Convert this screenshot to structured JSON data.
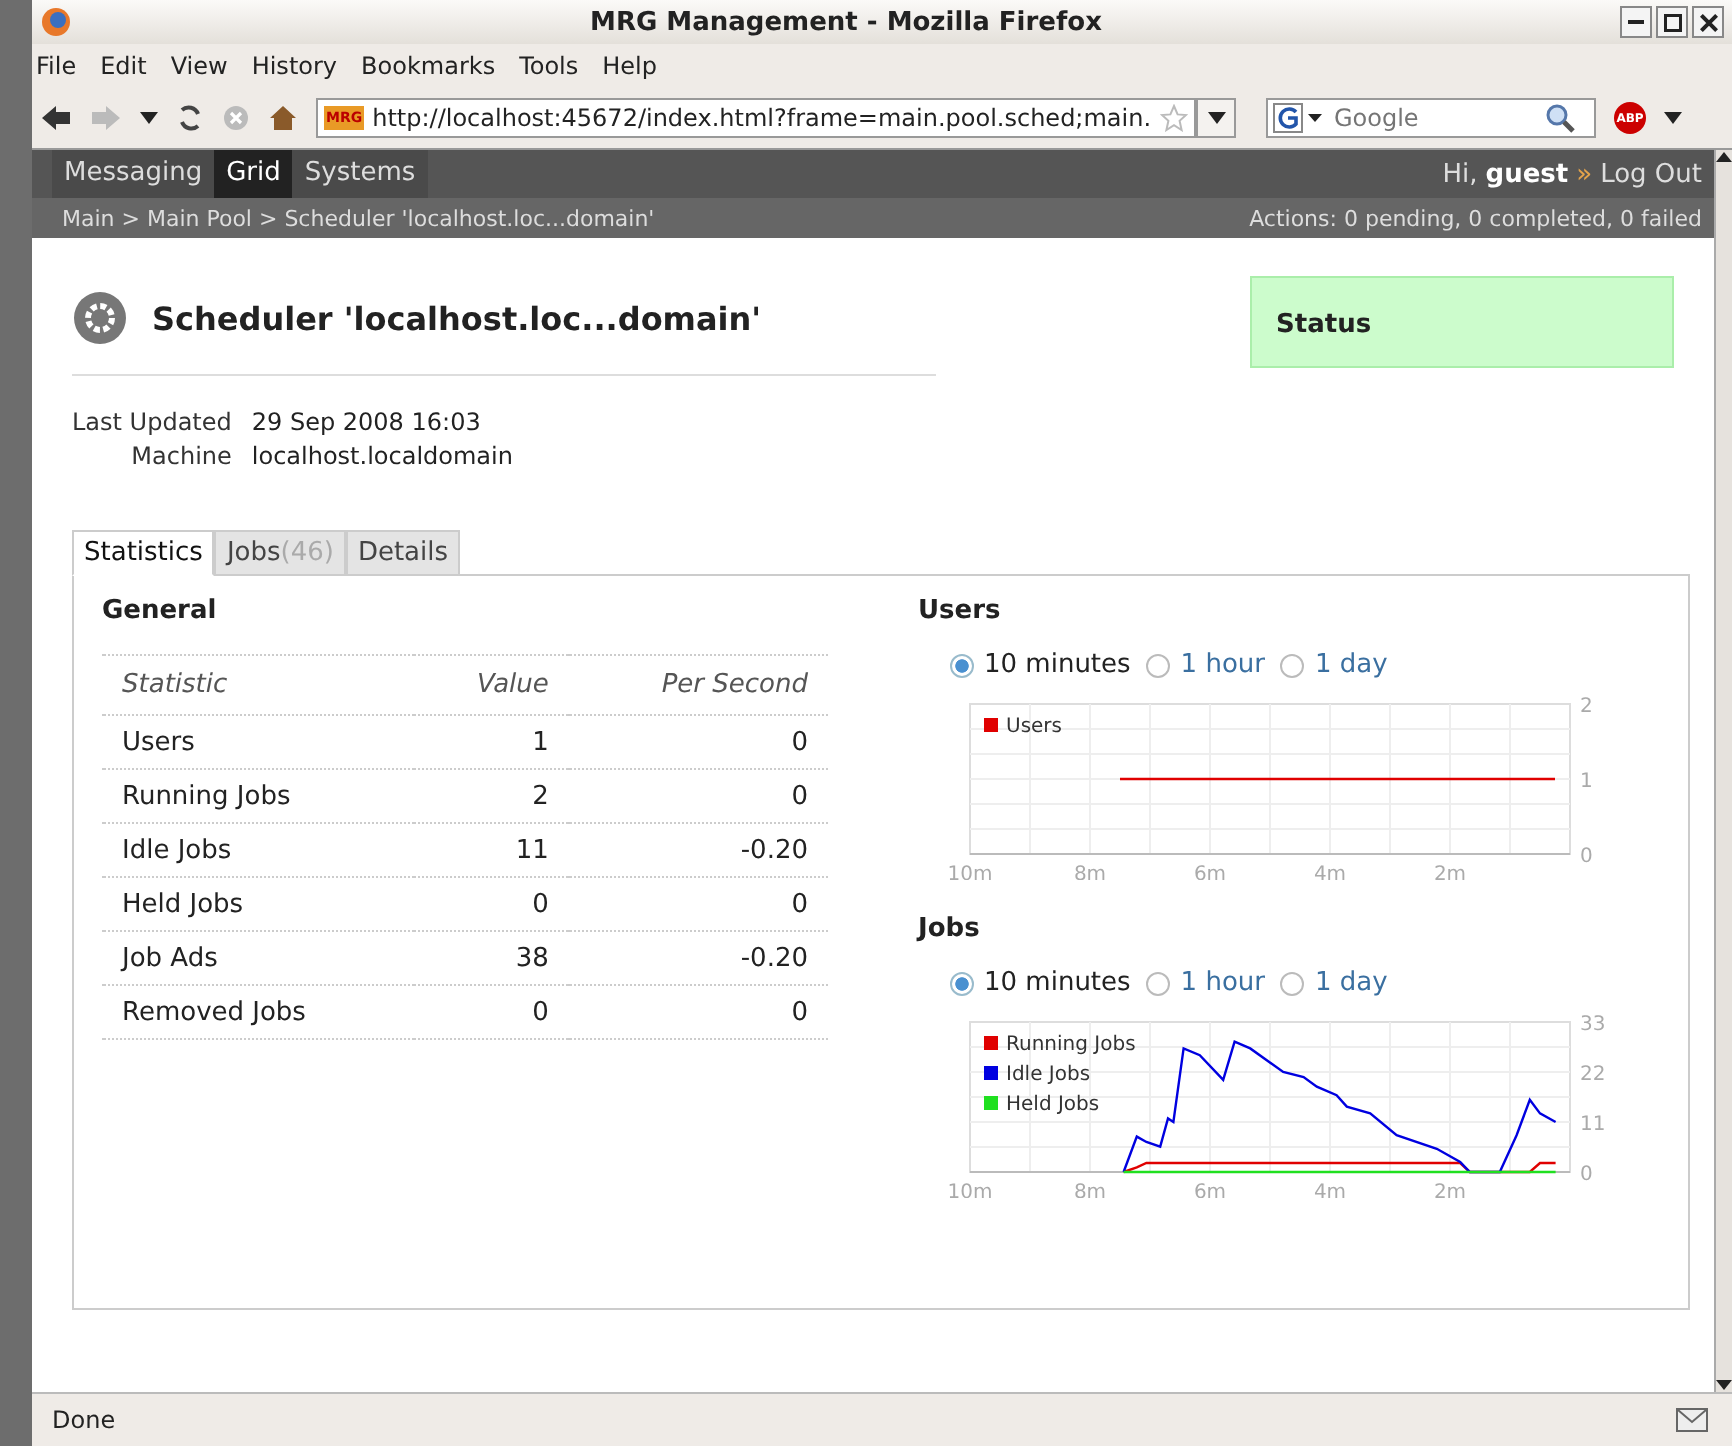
{
  "window": {
    "title": "MRG Management - Mozilla Firefox"
  },
  "menu": [
    "File",
    "Edit",
    "View",
    "History",
    "Bookmarks",
    "Tools",
    "Help"
  ],
  "toolbar": {
    "favicon_text": "MRG",
    "url": "http://localhost:45672/index.html?frame=main.pool.sched;main.",
    "search_placeholder": "Google",
    "adblock_text": "ABP"
  },
  "nav": {
    "tabs": [
      {
        "label": "Messaging",
        "selected": false
      },
      {
        "label": "Grid",
        "selected": true
      },
      {
        "label": "Systems",
        "selected": false
      }
    ],
    "greeting": "Hi,",
    "user": "guest",
    "separator": "»",
    "logout": "Log Out"
  },
  "breadcrumb": {
    "path": "Main > Main Pool > Scheduler 'localhost.loc...domain'",
    "actions": "Actions: 0 pending, 0 completed, 0 failed"
  },
  "page": {
    "title": "Scheduler 'localhost.loc...domain'",
    "status_label": "Status",
    "properties": [
      {
        "label": "Last Updated",
        "value": "29 Sep 2008 16:03"
      },
      {
        "label": "Machine",
        "value": "localhost.localdomain"
      }
    ]
  },
  "tabs": [
    {
      "label": "Statistics",
      "selected": true
    },
    {
      "label": "Jobs",
      "count": "(46)",
      "selected": false
    },
    {
      "label": "Details",
      "selected": false
    }
  ],
  "general": {
    "title": "General",
    "columns": [
      "Statistic",
      "Value",
      "Per Second"
    ],
    "rows": [
      [
        "Users",
        "1",
        "0"
      ],
      [
        "Running Jobs",
        "2",
        "0"
      ],
      [
        "Idle Jobs",
        "11",
        "-0.20"
      ],
      [
        "Held Jobs",
        "0",
        "0"
      ],
      [
        "Job Ads",
        "38",
        "-0.20"
      ],
      [
        "Removed Jobs",
        "0",
        "0"
      ]
    ]
  },
  "charts": [
    {
      "title": "Users",
      "ranges": [
        {
          "label": "10 minutes",
          "selected": true
        },
        {
          "label": "1 hour",
          "selected": false
        },
        {
          "label": "1 day",
          "selected": false
        }
      ],
      "chart_data": {
        "type": "line",
        "x": [
          7.5,
          0.25
        ],
        "series": [
          {
            "name": "Users",
            "color": "#e00000",
            "values": [
              1,
              1
            ]
          }
        ],
        "xlim": [
          10,
          0
        ],
        "ylim": [
          0,
          2
        ],
        "legend": "upper left",
        "grid": true,
        "xticks": [
          {
            "value": 10,
            "label": "10m"
          },
          {
            "value": 8,
            "label": "8m"
          },
          {
            "value": 6,
            "label": "6m"
          },
          {
            "value": 4,
            "label": "4m"
          },
          {
            "value": 2,
            "label": "2m"
          }
        ],
        "yticks": [
          0,
          1,
          2
        ]
      }
    },
    {
      "title": "Jobs",
      "ranges": [
        {
          "label": "10 minutes",
          "selected": true
        },
        {
          "label": "1 hour",
          "selected": false
        },
        {
          "label": "1 day",
          "selected": false
        }
      ],
      "chart_data": {
        "type": "line",
        "x": [
          7.44,
          7.22,
          7.06,
          6.83,
          6.7,
          6.61,
          6.44,
          6.17,
          5.78,
          5.59,
          5.33,
          4.78,
          4.44,
          4.22,
          3.89,
          3.72,
          3.33,
          2.89,
          2.22,
          1.83,
          1.67,
          1.17,
          0.89,
          0.67,
          0.5,
          0.24
        ],
        "series": [
          {
            "name": "Running Jobs",
            "color": "#e00000",
            "values": [
              0,
              1,
              2,
              2,
              2,
              2,
              2,
              2,
              2,
              2,
              2,
              2,
              2,
              2,
              2,
              2,
              2,
              2,
              2,
              2,
              0,
              0,
              0,
              0,
              2,
              2
            ]
          },
          {
            "name": "Idle Jobs",
            "color": "#0000e0",
            "values": [
              0,
              7.8,
              6.6,
              5.6,
              11.8,
              11,
              27.2,
              25.7,
              20.3,
              28.7,
              27.2,
              22,
              20.9,
              18.8,
              16.9,
              14.4,
              12.9,
              8.1,
              5.1,
              2.2,
              0,
              0,
              8.1,
              15.9,
              12.9,
              11
            ]
          },
          {
            "name": "Held Jobs",
            "color": "#20e020",
            "values": [
              0,
              0,
              0,
              0,
              0,
              0,
              0,
              0,
              0,
              0,
              0,
              0,
              0,
              0,
              0,
              0,
              0,
              0,
              0,
              0,
              0,
              0,
              0,
              0,
              0,
              0
            ]
          }
        ],
        "xlim": [
          10,
          0
        ],
        "ylim": [
          0,
          33
        ],
        "legend": "upper left",
        "grid": true,
        "xticks": [
          {
            "value": 10,
            "label": "10m"
          },
          {
            "value": 8,
            "label": "8m"
          },
          {
            "value": 6,
            "label": "6m"
          },
          {
            "value": 4,
            "label": "4m"
          },
          {
            "value": 2,
            "label": "2m"
          }
        ],
        "yticks": [
          0,
          11,
          22,
          33
        ]
      }
    }
  ],
  "status_bar": {
    "text": "Done"
  }
}
